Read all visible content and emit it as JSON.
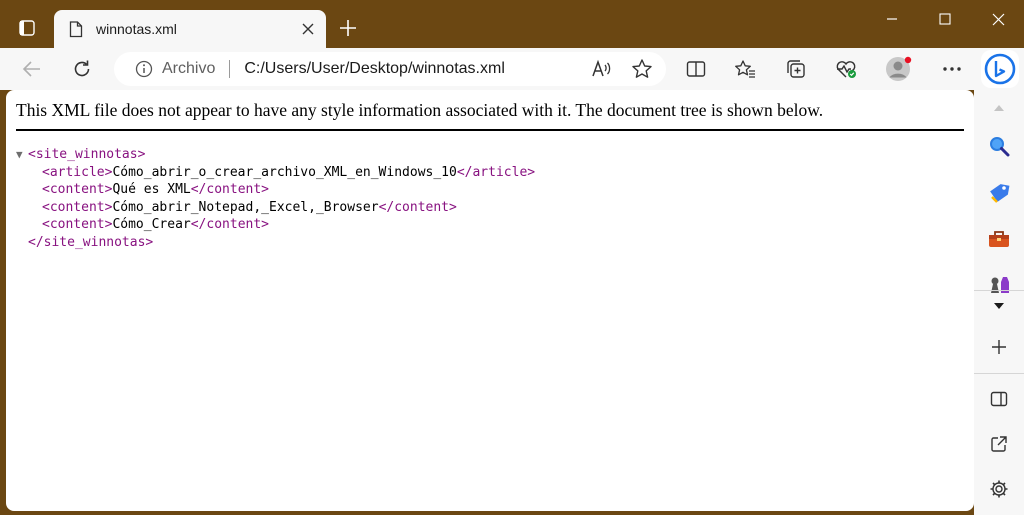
{
  "browser": {
    "tab": {
      "title": "winnotas.xml"
    },
    "address": {
      "site_label": "Archivo",
      "url": "C:/Users/User/Desktop/winnotas.xml"
    },
    "colors": {
      "frame": "#6b4712",
      "toolbar": "#f7f7f7",
      "tag": "#881280"
    }
  },
  "document": {
    "banner": "This XML file does not appear to have any style information associated with it. The document tree is shown below.",
    "tree": {
      "collapse_glyph": "▼",
      "root_open": "<site_winnotas>",
      "root_close": "</site_winnotas>",
      "children": [
        {
          "open": "<article>",
          "text": "Cómo_abrir_o_crear_archivo_XML_en_Windows_10",
          "close": "</article>"
        },
        {
          "open": "<content>",
          "text": "Qué es XML",
          "close": "</content>"
        },
        {
          "open": "<content>",
          "text": "Cómo_abrir_Notepad,_Excel,_Browser",
          "close": "</content>"
        },
        {
          "open": "<content>",
          "text": "Cómo_Crear",
          "close": "</content>"
        }
      ]
    }
  },
  "icons": {
    "tab_actions": "tab-actions-icon",
    "favicon": "document-icon",
    "back": "back-arrow-icon",
    "refresh": "refresh-icon",
    "read_aloud": "read-aloud-icon",
    "favorite": "star-icon",
    "split_screen": "split-screen-icon",
    "favorites": "favorites-icon",
    "collections": "collections-icon",
    "browser_essentials": "heart-pulse-icon",
    "profile": "profile-avatar-icon",
    "more": "more-options-icon",
    "bing": "bing-copilot-icon"
  }
}
